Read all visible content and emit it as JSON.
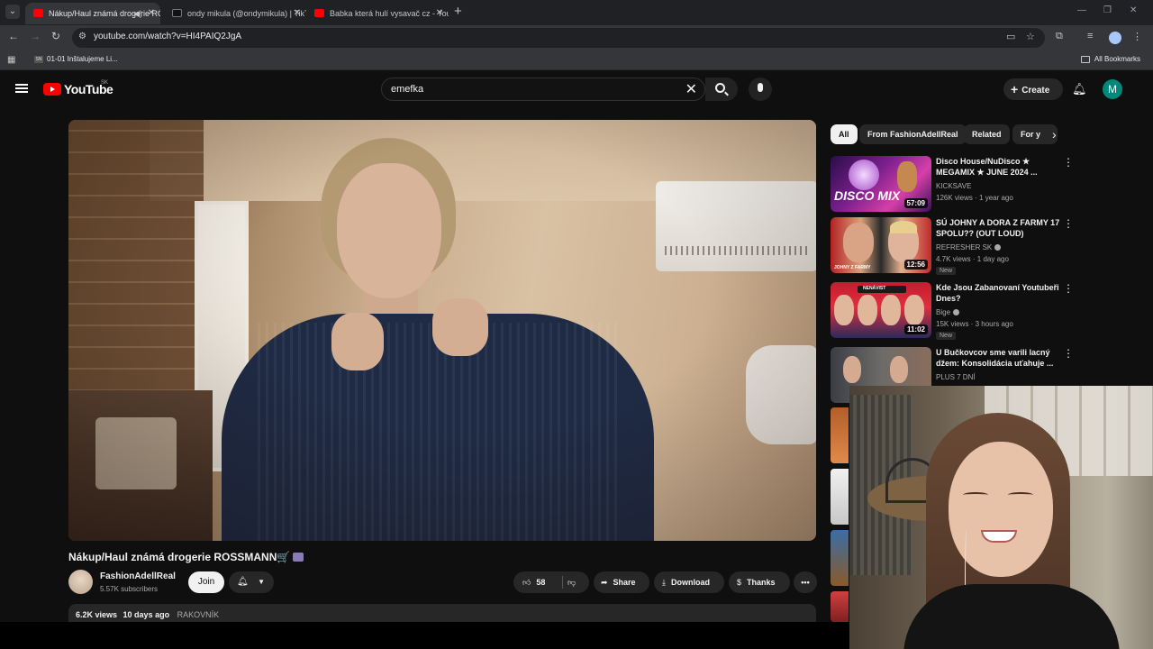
{
  "browser": {
    "tabs": [
      {
        "title": "Nákup/Haul známá drogerie ROSSMANN",
        "favicon": "youtube-icon"
      },
      {
        "title": "ondy mikula (@ondymikula) | TikTok",
        "favicon": "tiktok-icon"
      },
      {
        "title": "Babka která hulí vysavač cz - YouTube",
        "favicon": "youtube-icon"
      }
    ],
    "url": "youtube.com/watch?v=HI4PAIQ2JgA",
    "bookmark": "01-01 Inštalujeme Li...",
    "bookmark_badge": "SN",
    "all_bookmarks": "All Bookmarks"
  },
  "youtube": {
    "logo_text": "YouTube",
    "country": "SK",
    "search_query": "emefka",
    "create_label": "Create",
    "avatar_letter": "M"
  },
  "video": {
    "title": "Nákup/Haul známá drogerie ROSSMANN🛒",
    "channel": "FashionAdellReal",
    "subscribers": "5.57K subscribers",
    "join_label": "Join",
    "likes": "58",
    "share_label": "Share",
    "download_label": "Download",
    "thanks_label": "Thanks",
    "views": "6.2K views",
    "age": "10 days ago",
    "location": "RAKOVNÍK"
  },
  "chips": [
    "All",
    "From FashionAdellReal",
    "Related",
    "For y"
  ],
  "recommendations": [
    {
      "title": "Disco House/NuDisco ★ MEGAMIX ★ JUNE 2024 ...",
      "channel": "KICKSAVE",
      "verified": false,
      "meta": "126K views · 1 year ago",
      "duration": "57:09",
      "thumb_text": "DISCO MIX",
      "new": ""
    },
    {
      "title": "SÚ JOHNY A DORA Z FARMY 17 SPOLU?? (OUT LOUD)",
      "channel": "REFRESHER SK",
      "verified": true,
      "meta": "4.7K views · 1 day ago",
      "duration": "12:56",
      "thumb_text": "JOHNY Z FARMY",
      "new": "New"
    },
    {
      "title": "Kde Jsou Zabanovaní Youtubeři Dnes?",
      "channel": "Bige",
      "verified": true,
      "meta": "15K views · 3 hours ago",
      "duration": "11:02",
      "thumb_text": "NENÁVIST",
      "new": "New"
    },
    {
      "title": "U Bučkovcov sme varili lacný džem: Konsolidácia uťahuje ...",
      "channel": "PLUS 7 DNÍ",
      "verified": false,
      "meta": "",
      "duration": "",
      "thumb_text": "",
      "new": ""
    }
  ]
}
